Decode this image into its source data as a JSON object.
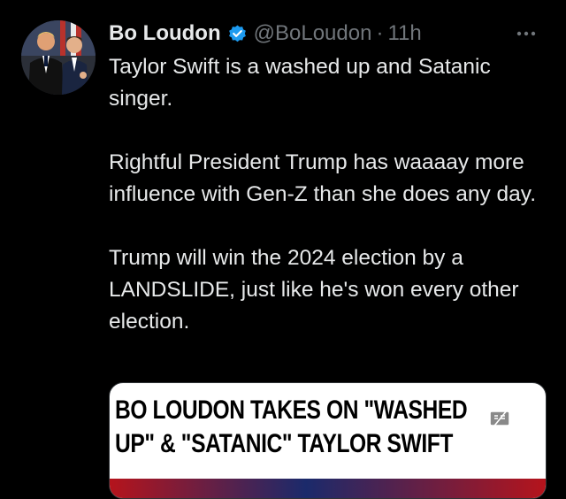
{
  "tweet": {
    "display_name": "Bo Loudon",
    "handle": "@BoLoudon",
    "separator": "·",
    "time": "11h",
    "paragraphs": [
      "Taylor Swift is a washed up and Satanic singer.",
      "Rightful President Trump has waaaay more influence with Gen-Z than she does any day.",
      "Trump will win the 2024 election by a LANDSLIDE, just like he's won every other election."
    ]
  },
  "media": {
    "headline_line1": "BO LOUDON TAKES ON \"WASHED",
    "headline_line2": "UP\" & \"SATANIC\" TAYLOR SWIFT"
  },
  "icons": {
    "verified": "verified-badge-icon",
    "more": "more-horizontal-icon",
    "caption": "caption-icon"
  },
  "colors": {
    "background": "#000000",
    "text_primary": "#e7e9ea",
    "text_secondary": "#71767b",
    "verified_blue": "#1d9bf0"
  }
}
